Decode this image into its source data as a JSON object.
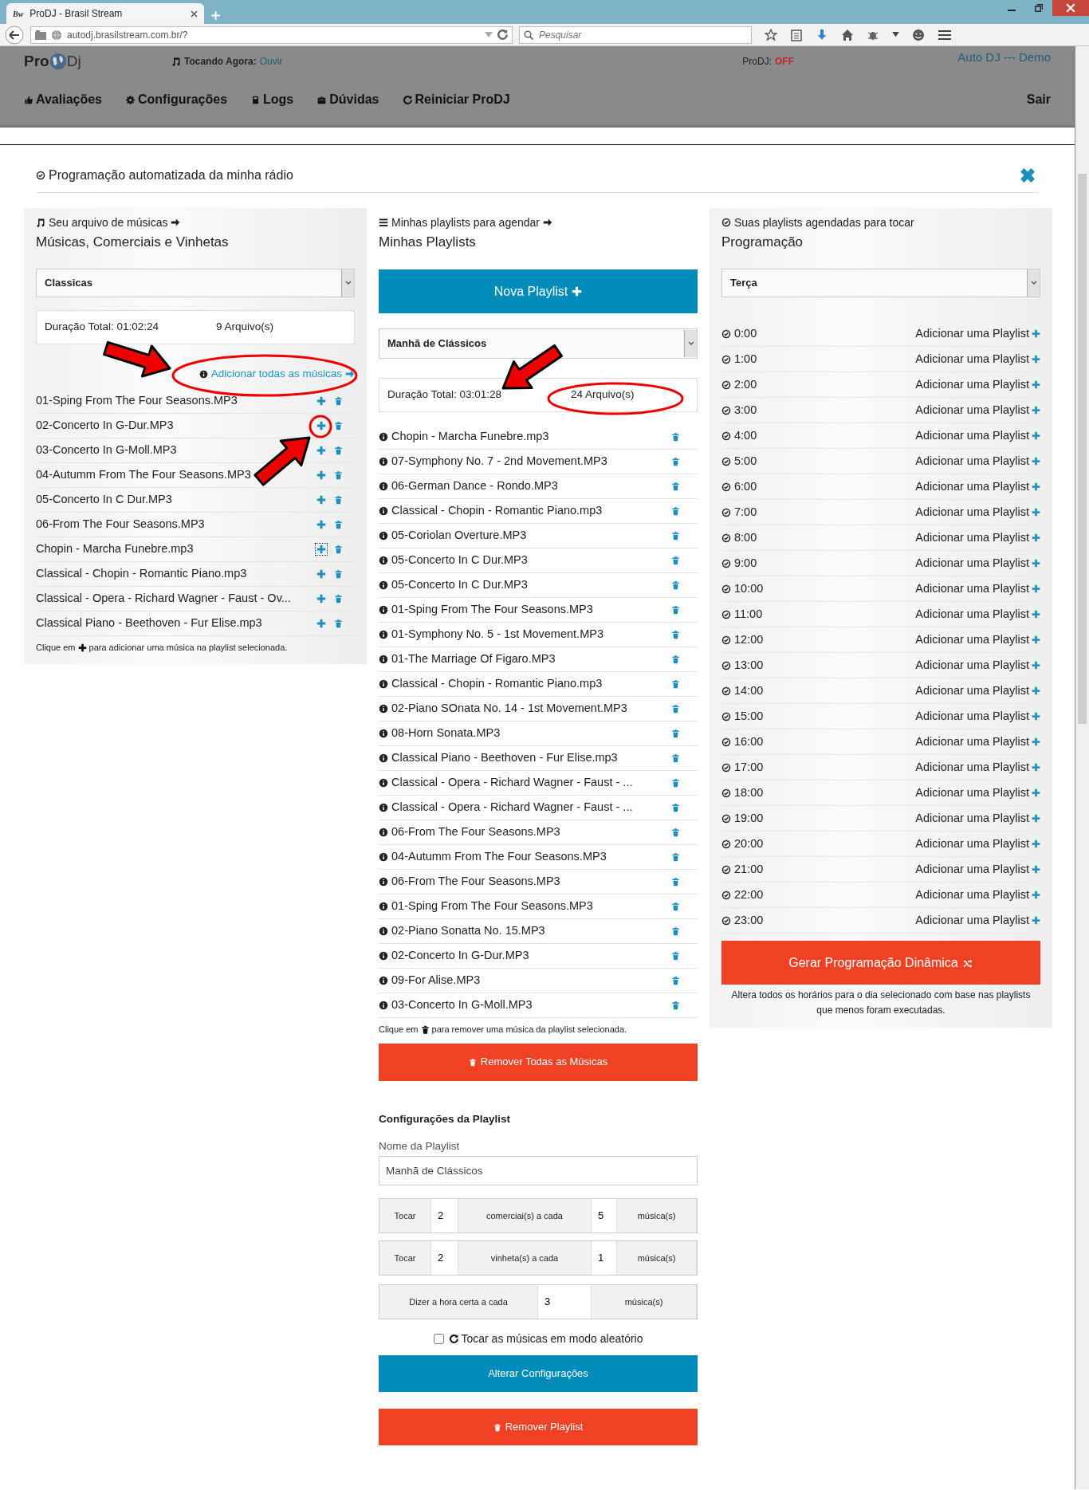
{
  "browser": {
    "tab_title": "ProDJ - Brasil Stream",
    "tab_logo": "Bw",
    "url": "autodj.brasilstream.com.br/?",
    "search_placeholder": "Pesquisar"
  },
  "header": {
    "logo_left": "Pro",
    "logo_right": "Dj",
    "now_playing_label": "Tocando Agora:",
    "now_playing_link": "Ouvir",
    "status_label": "ProDJ:",
    "status_value": "OFF",
    "account": "Auto DJ --- Demo",
    "nav": [
      "Avaliações",
      "Configurações",
      "Logs",
      "Dúvidas",
      "Reiniciar ProDJ"
    ],
    "logout": "Sair"
  },
  "modal": {
    "title": "Programação automatizada da minha rádio",
    "library": {
      "caption": "Seu arquivo de músicas",
      "heading": "Músicas, Comerciais e Vinhetas",
      "category": "Classicas",
      "duration": "Duração Total: 01:02:24",
      "count": "9 Arquivo(s)",
      "add_all": "Adicionar todas as músicas",
      "items": [
        {
          "name": "01-Sping From The Four Seasons.MP3",
          "focused": false
        },
        {
          "name": "02-Concerto In G-Dur.MP3",
          "focused": false
        },
        {
          "name": "03-Concerto In G-Moll.MP3",
          "focused": false
        },
        {
          "name": "04-Autumm From The Four Seasons.MP3",
          "focused": false
        },
        {
          "name": "05-Concerto In C Dur.MP3",
          "focused": false
        },
        {
          "name": "06-From The Four Seasons.MP3",
          "focused": false
        },
        {
          "name": "Chopin - Marcha Funebre.mp3",
          "focused": true
        },
        {
          "name": "Classical - Chopin - Romantic Piano.mp3",
          "focused": false
        },
        {
          "name": "Classical - Opera - Richard Wagner - Faust - Ov...",
          "focused": false
        },
        {
          "name": "Classical Piano - Beethoven - Fur Elise.mp3",
          "focused": false
        }
      ],
      "hint_before": "Clique em",
      "hint_after": "para adicionar uma música na playlist selecionada."
    },
    "playlists": {
      "caption": "Minhas playlists para agendar",
      "heading": "Minhas Playlists",
      "new_button": "Nova Playlist",
      "selected_playlist": "Manhã de Clássicos",
      "duration": "Duração Total: 03:01:28",
      "count": "24 Arquivo(s)",
      "items": [
        "Chopin - Marcha Funebre.mp3",
        "07-Symphony No. 7 - 2nd Movement.MP3",
        "06-German Dance - Rondo.MP3",
        "Classical - Chopin - Romantic Piano.mp3",
        "05-Coriolan Overture.MP3",
        "05-Concerto In C Dur.MP3",
        "05-Concerto In C Dur.MP3",
        "01-Sping From The Four Seasons.MP3",
        "01-Symphony No. 5 - 1st Movement.MP3",
        "01-The Marriage Of Figaro.MP3",
        "Classical - Chopin - Romantic Piano.mp3",
        "02-Piano SOnata No. 14 - 1st Movement.MP3",
        "08-Horn Sonata.MP3",
        "Classical Piano - Beethoven - Fur Elise.mp3",
        "Classical - Opera - Richard Wagner - Faust - ...",
        "Classical - Opera - Richard Wagner - Faust - ...",
        "06-From The Four Seasons.MP3",
        "04-Autumm From The Four Seasons.MP3",
        "06-From The Four Seasons.MP3",
        "01-Sping From The Four Seasons.MP3",
        "02-Piano Sonatta No. 15.MP3",
        "02-Concerto In G-Dur.MP3",
        "09-For Alise.MP3",
        "03-Concerto In G-Moll.MP3"
      ],
      "hint_before": "Clique em",
      "hint_after": "para remover uma música da playlist selecionada.",
      "remove_all": "Remover Todas as Músicas",
      "settings": {
        "heading": "Configurações da Playlist",
        "name_label": "Nome da Playlist",
        "name_value": "Manhã de Clássicos",
        "groups": [
          [
            {
              "kind": "label",
              "text": "Tocar"
            },
            {
              "kind": "input",
              "text": "2"
            },
            {
              "kind": "label",
              "text": "comerciai(s) a cada"
            },
            {
              "kind": "input",
              "text": "5"
            },
            {
              "kind": "label",
              "text": "música(s)"
            }
          ],
          [
            {
              "kind": "label",
              "text": "Tocar"
            },
            {
              "kind": "input",
              "text": "2"
            },
            {
              "kind": "label",
              "text": "vinheta(s) a cada"
            },
            {
              "kind": "input",
              "text": "1"
            },
            {
              "kind": "label",
              "text": "música(s)"
            }
          ],
          [
            {
              "kind": "label",
              "text": "Dizer a hora certa a cada"
            },
            {
              "kind": "input",
              "text": "3"
            },
            {
              "kind": "label",
              "text": "música(s)"
            }
          ]
        ],
        "shuffle": {
          "label": "Tocar as músicas em modo aleatório",
          "checked": false
        },
        "save_button": "Alterar Configurações",
        "delete_button": "Remover Playlist"
      }
    },
    "schedule": {
      "caption": "Suas playlists agendadas para tocar",
      "heading": "Programação",
      "day": "Terça",
      "slots": [
        {
          "time": "0:00",
          "action": "Adicionar uma Playlist"
        },
        {
          "time": "1:00",
          "action": "Adicionar uma Playlist"
        },
        {
          "time": "2:00",
          "action": "Adicionar uma Playlist"
        },
        {
          "time": "3:00",
          "action": "Adicionar uma Playlist"
        },
        {
          "time": "4:00",
          "action": "Adicionar uma Playlist"
        },
        {
          "time": "5:00",
          "action": "Adicionar uma Playlist"
        },
        {
          "time": "6:00",
          "action": "Adicionar uma Playlist"
        },
        {
          "time": "7:00",
          "action": "Adicionar uma Playlist"
        },
        {
          "time": "8:00",
          "action": "Adicionar uma Playlist"
        },
        {
          "time": "9:00",
          "action": "Adicionar uma Playlist"
        },
        {
          "time": "10:00",
          "action": "Adicionar uma Playlist"
        },
        {
          "time": "11:00",
          "action": "Adicionar uma Playlist"
        },
        {
          "time": "12:00",
          "action": "Adicionar uma Playlist"
        },
        {
          "time": "13:00",
          "action": "Adicionar uma Playlist"
        },
        {
          "time": "14:00",
          "action": "Adicionar uma Playlist"
        },
        {
          "time": "15:00",
          "action": "Adicionar uma Playlist"
        },
        {
          "time": "16:00",
          "action": "Adicionar uma Playlist"
        },
        {
          "time": "17:00",
          "action": "Adicionar uma Playlist"
        },
        {
          "time": "18:00",
          "action": "Adicionar uma Playlist"
        },
        {
          "time": "19:00",
          "action": "Adicionar uma Playlist"
        },
        {
          "time": "20:00",
          "action": "Adicionar uma Playlist"
        },
        {
          "time": "21:00",
          "action": "Adicionar uma Playlist"
        },
        {
          "time": "22:00",
          "action": "Adicionar uma Playlist"
        },
        {
          "time": "23:00",
          "action": "Adicionar uma Playlist"
        }
      ],
      "generate_button": "Gerar Programação Dinâmica",
      "generate_note": "Altera todos os horários para o dia selecionado com base nas playlists que menos foram executadas."
    }
  }
}
